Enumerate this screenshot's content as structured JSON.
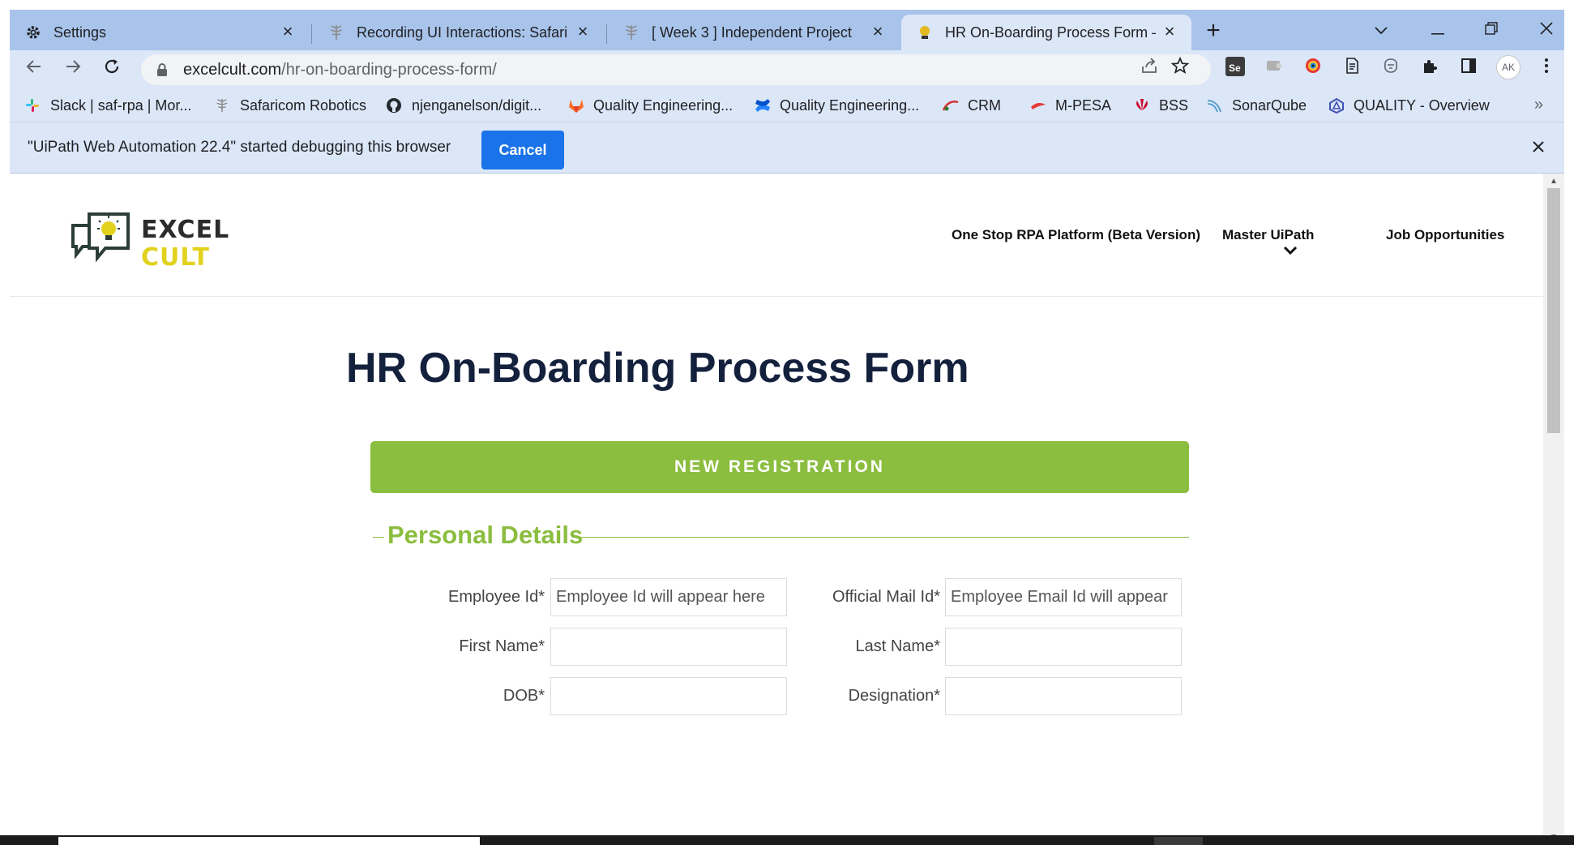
{
  "browser": {
    "tabs": [
      {
        "label": "Settings",
        "icon": "gear-icon"
      },
      {
        "label": "Recording UI Interactions: Safaric",
        "icon": "tree-icon"
      },
      {
        "label": "[ Week 3 ] Independent Project",
        "icon": "tree-icon"
      },
      {
        "label": "HR On-Boarding Process Form –",
        "icon": "excelcult-icon"
      }
    ],
    "new_tab": "+",
    "url_host": "excelcult.com",
    "url_path": "/hr-on-boarding-process-form/",
    "profile": "AK",
    "bookmarks": [
      {
        "label": "Slack | saf-rpa | Mor...",
        "color": "#e01e5a"
      },
      {
        "label": "Safaricom Robotics",
        "color": "#9e9e9e"
      },
      {
        "label": "njenganelson/digit...",
        "color": "#24292e"
      },
      {
        "label": "Quality Engineering...",
        "color": "#fc6d26"
      },
      {
        "label": "Quality Engineering...",
        "color": "#2684ff"
      },
      {
        "label": "CRM",
        "color": "#d32f2f"
      },
      {
        "label": "M-PESA",
        "color": "#e53935"
      },
      {
        "label": "BSS",
        "color": "#cf0a2c"
      },
      {
        "label": "SonarQube",
        "color": "#4e9bcd"
      },
      {
        "label": "QUALITY - Overview",
        "color": "#3f51b5"
      }
    ],
    "bookmarks_more": "»",
    "infobar": {
      "message": "\"UiPath Web Automation 22.4\" started debugging this browser",
      "cancel_label": "Cancel"
    }
  },
  "site": {
    "logo": {
      "line1": "EXCEL",
      "line2": "CULT"
    },
    "nav": [
      {
        "label": "One Stop RPA Platform (Beta Version)"
      },
      {
        "label": "Master UiPath"
      },
      {
        "label": "Job Opportunities"
      }
    ],
    "title": "HR On-Boarding Process Form",
    "new_registration": "NEW REGISTRATION",
    "section_title": "Personal Details",
    "fields": [
      {
        "label": "Employee Id*",
        "placeholder": "Employee Id will appear here",
        "value": ""
      },
      {
        "label": "Official Mail Id*",
        "placeholder": "Employee Email Id will appear",
        "value": ""
      },
      {
        "label": "First Name*",
        "placeholder": "",
        "value": ""
      },
      {
        "label": "Last Name*",
        "placeholder": "",
        "value": ""
      },
      {
        "label": "DOB*",
        "placeholder": "",
        "value": ""
      },
      {
        "label": "Designation*",
        "placeholder": "",
        "value": ""
      }
    ]
  },
  "colors": {
    "accent_green": "#8bbd3f",
    "title_navy": "#14213d",
    "cancel_blue": "#1a73e8",
    "chrome_tab_bg": "#a9c4eb"
  }
}
